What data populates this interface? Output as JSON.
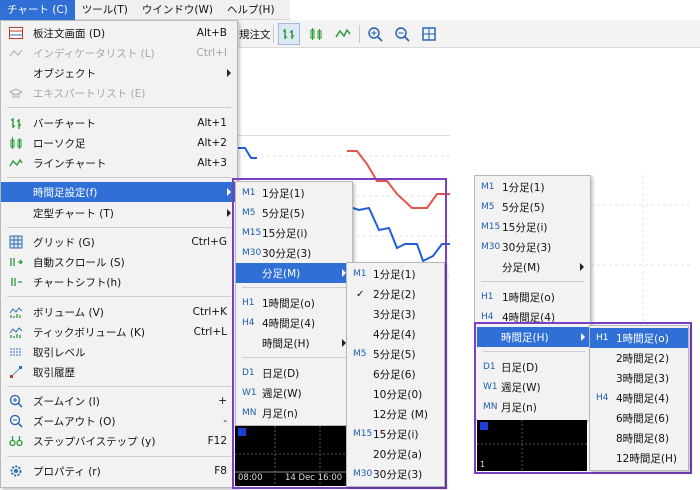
{
  "menubar": {
    "items": [
      "チャート (C)",
      "ツール(T)",
      "ウインドウ(W)",
      "ヘルプ(H)"
    ]
  },
  "toolbar": {
    "partial_text": "規注文"
  },
  "chart_menu": {
    "items": [
      {
        "icon": "order-book-icon",
        "label": "板注文画面 (D)",
        "shortcut": "Alt+B"
      },
      {
        "icon": "indicator-list-icon",
        "label": "インディケータリスト (L)",
        "shortcut": "Ctrl+I",
        "disabled": true
      },
      {
        "label": "オブジェクト",
        "submenu": true
      },
      {
        "icon": "expert-list-icon",
        "label": "エキスパートリスト (E)",
        "disabled": true
      },
      {
        "icon": "bar-chart-icon",
        "label": "バーチャート",
        "shortcut": "Alt+1"
      },
      {
        "icon": "candlestick-icon",
        "label": "ローソク足",
        "shortcut": "Alt+2"
      },
      {
        "icon": "line-chart-icon",
        "label": "ラインチャート",
        "shortcut": "Alt+3"
      },
      {
        "label": "時間足設定(f)",
        "submenu": true,
        "highlighted": true
      },
      {
        "label": "定型チャート (T)",
        "submenu": true
      },
      {
        "icon": "grid-icon",
        "label": "グリッド (G)",
        "shortcut": "Ctrl+G"
      },
      {
        "icon": "auto-scroll-icon",
        "label": "自動スクロール (S)"
      },
      {
        "icon": "chart-shift-icon",
        "label": "チャートシフト(h)"
      },
      {
        "icon": "volume-icon",
        "label": "ボリューム (V)",
        "shortcut": "Ctrl+K"
      },
      {
        "icon": "tick-volume-icon",
        "label": "ティックボリューム (K)",
        "shortcut": "Ctrl+L"
      },
      {
        "icon": "trade-levels-icon",
        "label": "取引レベル"
      },
      {
        "icon": "trade-history-icon",
        "label": "取引履歴"
      },
      {
        "icon": "zoom-in-icon",
        "label": "ズームイン (I)",
        "shortcut": "+"
      },
      {
        "icon": "zoom-out-icon",
        "label": "ズームアウト (O)",
        "shortcut": "-"
      },
      {
        "icon": "step-icon",
        "label": "ステップバイステップ (y)",
        "shortcut": "F12"
      },
      {
        "icon": "properties-icon",
        "label": "プロパティ (r)",
        "shortcut": "F8"
      }
    ]
  },
  "timeframe_menu": {
    "items": [
      {
        "prefix": "M1",
        "label": "1分足(1)"
      },
      {
        "prefix": "M5",
        "label": "5分足(5)"
      },
      {
        "prefix": "M15",
        "label": "15分足(i)"
      },
      {
        "prefix": "M30",
        "label": "30分足(3)"
      },
      {
        "label": "分足(M)",
        "submenu": true,
        "highlighted": true
      },
      {
        "prefix": "H1",
        "label": "1時間足(o)"
      },
      {
        "prefix": "H4",
        "label": "4時間足(4)"
      },
      {
        "label": "時間足(H)",
        "submenu": true
      },
      {
        "prefix": "D1",
        "label": "日足(D)"
      },
      {
        "prefix": "W1",
        "label": "週足(W)"
      },
      {
        "prefix": "MN",
        "label": "月足(n)"
      }
    ]
  },
  "minutes_menu": {
    "items": [
      {
        "prefix": "M1",
        "label": "1分足(1)"
      },
      {
        "label": "2分足(2)",
        "checked": true
      },
      {
        "label": "3分足(3)"
      },
      {
        "label": "4分足(4)"
      },
      {
        "prefix": "M5",
        "label": "5分足(5)"
      },
      {
        "label": "6分足(6)"
      },
      {
        "label": "10分足(0)"
      },
      {
        "label": "12分足 (M)"
      },
      {
        "prefix": "M15",
        "label": "15分足(i)"
      },
      {
        "label": "20分足(a)"
      },
      {
        "prefix": "M30",
        "label": "30分足(3)"
      }
    ]
  },
  "right_menu": {
    "items": [
      {
        "prefix": "M1",
        "label": "1分足(1)"
      },
      {
        "prefix": "M5",
        "label": "5分足(5)"
      },
      {
        "prefix": "M15",
        "label": "15分足(i)"
      },
      {
        "prefix": "M30",
        "label": "30分足(3)"
      },
      {
        "label": "分足(M)",
        "submenu": true
      },
      {
        "prefix": "H1",
        "label": "1時間足(o)"
      },
      {
        "prefix": "H4",
        "label": "4時間足(4)"
      },
      {
        "label": "時間足(H)",
        "submenu": true,
        "highlighted": true
      },
      {
        "prefix": "D1",
        "label": "日足(D)"
      },
      {
        "prefix": "W1",
        "label": "週足(W)"
      },
      {
        "prefix": "MN",
        "label": "月足(n)"
      }
    ]
  },
  "hours_menu": {
    "items": [
      {
        "prefix": "H1",
        "label": "1時間足(o)",
        "highlighted": true
      },
      {
        "label": "2時間足(2)"
      },
      {
        "label": "3時間足(3)"
      },
      {
        "prefix": "H4",
        "label": "4時間足(4)"
      },
      {
        "label": "6時間足(6)"
      },
      {
        "label": "8時間足(8)"
      },
      {
        "label": "12時間足(H)"
      }
    ]
  },
  "chart_axis": {
    "time1": "08:00",
    "time2": "14 Dec 16:00",
    "time3": "1"
  },
  "colors": {
    "accent": "#2f6fd6",
    "outline": "#7b3fc4",
    "red_line": "#e0554a",
    "blue_line": "#1f5fd8"
  }
}
